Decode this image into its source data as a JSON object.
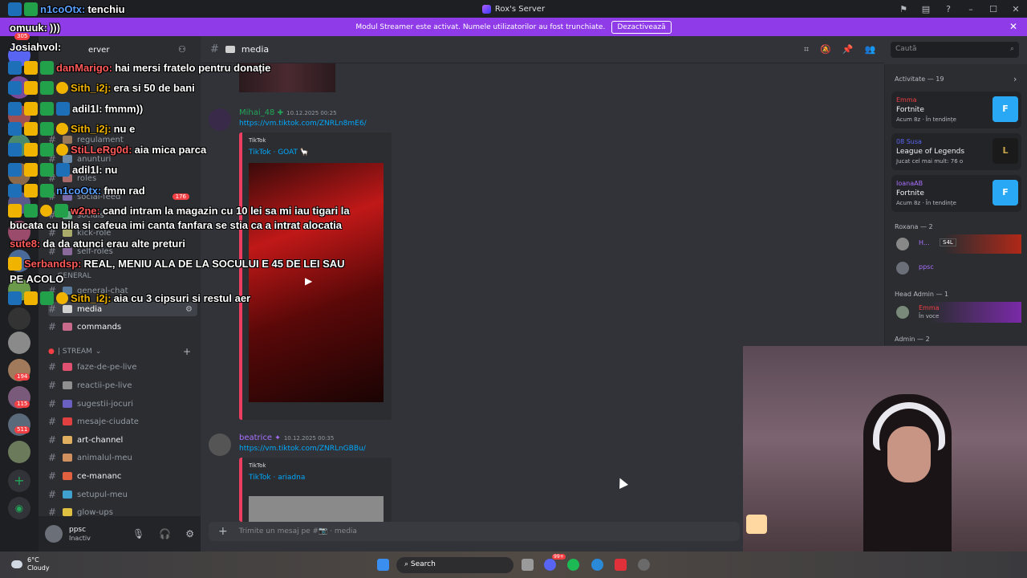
{
  "window": {
    "title": "Rox's Server",
    "controls": [
      "flag-icon",
      "inbox-icon",
      "help-icon",
      "minimize",
      "maximize",
      "close"
    ]
  },
  "banner": {
    "text": "Modul Streamer este activat. Numele utilizatorilor au fost trunchiate.",
    "button": "Dezactivează"
  },
  "rail": {
    "badges": [
      "305",
      "194",
      "115",
      "511",
      "1"
    ]
  },
  "sidebar": {
    "server_name": "Rox's Server",
    "visible_name_fragment": "erver",
    "channels": [
      {
        "label": "regulament"
      },
      {
        "label": "anunturi"
      },
      {
        "label": "roles"
      },
      {
        "label": "social-feed",
        "badge": "176"
      },
      {
        "label": "socials"
      },
      {
        "label": "kick-role"
      },
      {
        "label": "self-roles"
      },
      {
        "label": "GENERAL"
      },
      {
        "label": "general-chat"
      },
      {
        "label": "media"
      },
      {
        "label": "commands"
      }
    ],
    "stream_category": "| STREAM",
    "stream_channels": [
      {
        "label": "faze-de-pe-live"
      },
      {
        "label": "reactii-pe-live"
      },
      {
        "label": "sugestii-jocuri"
      },
      {
        "label": "mesaje-ciudate"
      },
      {
        "label": "art-channel"
      },
      {
        "label": "animalul-meu"
      },
      {
        "label": "ce-mananc"
      },
      {
        "label": "setupul-meu"
      },
      {
        "label": "glow-ups"
      }
    ],
    "user": {
      "name": "ppsc",
      "status": "Inactiv"
    }
  },
  "header": {
    "channel": "media",
    "search_placeholder": "Caută"
  },
  "messages": [
    {
      "author": "Mihai_48",
      "timestamp": "10.12.2025 00:25",
      "link": "https://vm.tiktok.com/ZNRLn8mE6/",
      "embed_provider": "TikTok",
      "embed_title": "TikTok · GOAT 🦙"
    },
    {
      "author": "beatrice",
      "timestamp": "10.12.2025 00:35",
      "link": "https://vm.tiktok.com/ZNRLnGBBu/",
      "embed_provider": "TikTok",
      "embed_title": "TikTok · ariadna"
    }
  ],
  "composer": {
    "placeholder": "Trimite un mesaj pe #📷 · media"
  },
  "activity": {
    "header": "Activitate — 19",
    "cards": [
      {
        "user": "Emma",
        "game": "Fortnite",
        "status": "Acum 8z · În tendințe",
        "color": "#f23f43",
        "icon_color": "#29a9f5"
      },
      {
        "user": "08 Susa",
        "game": "League of Legends",
        "status": "Jucat cel mai mult: 76 o",
        "color": "#5865f2",
        "icon_color": "#c8a548"
      },
      {
        "user": "IoanaAB",
        "game": "Fortnite",
        "status": "Acum 8z · În tendințe",
        "color": "#a970ff",
        "icon_color": "#29a9f5"
      }
    ],
    "sections": [
      {
        "label": "Roxana — 2"
      },
      {
        "label": "Head Admin — 1"
      },
      {
        "label": "Admin — 2"
      }
    ],
    "roxana_members": [
      "H...",
      "ppsc"
    ],
    "roxana_badge": "S4L",
    "head_admin_member": {
      "name": "Emma",
      "status": "În voce"
    }
  },
  "overlay_chat": [
    {
      "user": "n1coOtx:",
      "text": "tenchiu",
      "color": "#5aa0ff"
    },
    {
      "user": "omuuk:",
      "text": ")))",
      "color": "#ffffff"
    },
    {
      "user": "Josiahvol:",
      "text": "",
      "color": "#ffffff"
    },
    {
      "user": "danMarigo:",
      "text": "hai mersi fratelo pentru donație",
      "color": "#ff5a5a"
    },
    {
      "user": "Sith_i2j:",
      "text": "era si 50 de bani",
      "color": "#f0b400"
    },
    {
      "user": "adil1l:",
      "text": "fmmm))",
      "color": "#ffffff"
    },
    {
      "user": "Sith_i2j:",
      "text": "nu e",
      "color": "#f0b400"
    },
    {
      "user": "StiLLeRg0d:",
      "text": "aia mica parca",
      "color": "#ff5a5a"
    },
    {
      "user": "adil1l:",
      "text": "nu",
      "color": "#ffffff"
    },
    {
      "user": "n1coOtx:",
      "text": "fmm rad",
      "color": "#5aa0ff"
    },
    {
      "user": "w2ne:",
      "text": "cand intram la magazin cu 10 lei sa mi iau tigari la",
      "color": "#ff5a5a"
    },
    {
      "user": "",
      "text": "bucata cu bila si cafeua imi canta fanfara se stia ca a intrat alocatia",
      "color": "#ffffff"
    },
    {
      "user": "sute8:",
      "text": "da da atunci erau alte preturi",
      "color": "#ff5a5a"
    },
    {
      "user": "Serbandsp:",
      "text": "REAL, MENIU ALA DE LA SOCULUI E 45 DE LEI SAU",
      "color": "#ff5a5a"
    },
    {
      "user": "",
      "text": "PE ACOLO",
      "color": "#ffffff"
    },
    {
      "user": "Sith_i2j:",
      "text": "aia cu 3 cipsuri si restul aer",
      "color": "#f0b400"
    }
  ],
  "taskbar": {
    "temperature": "6°C",
    "condition": "Cloudy",
    "search": "Search",
    "discord_badge": "99+"
  }
}
